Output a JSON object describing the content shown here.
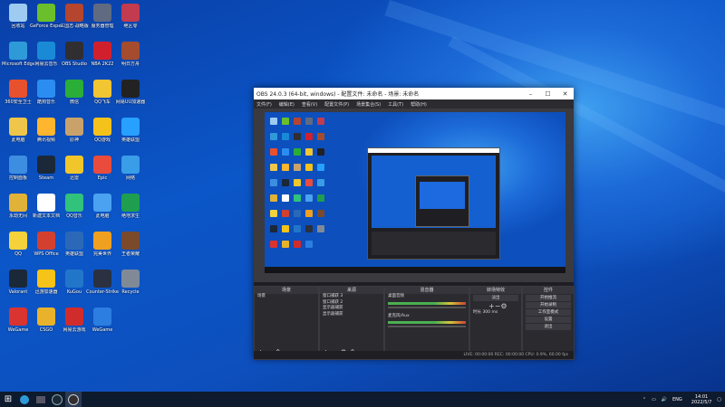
{
  "colors": {
    "desktop": "#0b56c8",
    "obs_bg": "#1f1f23",
    "accent": "#1c6ad8"
  },
  "desktop_icons": [
    {
      "label": "回收站",
      "color": "#9ecbf2"
    },
    {
      "label": "GeForce Experience",
      "color": "#6bbf2a"
    },
    {
      "label": "三国志·战略版",
      "color": "#b5452f"
    },
    {
      "label": "服务器管理",
      "color": "#606a80"
    },
    {
      "label": "绝区零",
      "color": "#c23b4e"
    },
    {
      "label": "Microsoft Edge",
      "color": "#2f9ad8"
    },
    {
      "label": "网易云音乐",
      "color": "#1a8ad6"
    },
    {
      "label": "OBS Studio",
      "color": "#302e31"
    },
    {
      "label": "NBA 2K22",
      "color": "#d1202d"
    },
    {
      "label": "明日方舟",
      "color": "#a44c2d"
    },
    {
      "label": "360安全卫士",
      "color": "#e8512d"
    },
    {
      "label": "酷狗音乐",
      "color": "#2c8df0"
    },
    {
      "label": "微信",
      "color": "#2aae38"
    },
    {
      "label": "QQ飞车",
      "color": "#f2c532"
    },
    {
      "label": "网易UU加速器",
      "color": "#222"
    },
    {
      "label": "此电脑",
      "color": "#f0c64a"
    },
    {
      "label": "腾讯视频",
      "color": "#ffb52e"
    },
    {
      "label": "原神",
      "color": "#c9a26b"
    },
    {
      "label": "QQ游戏",
      "color": "#f5c21b"
    },
    {
      "label": "英雄联盟",
      "color": "#28a0ff"
    },
    {
      "label": "控制面板",
      "color": "#3d8ee0"
    },
    {
      "label": "Steam",
      "color": "#1b2838"
    },
    {
      "label": "迅雷",
      "color": "#f1c62b"
    },
    {
      "label": "Epic",
      "color": "#e94b3c"
    },
    {
      "label": "网络",
      "color": "#3a9de8"
    },
    {
      "label": "永劫无间",
      "color": "#e0b237"
    },
    {
      "label": "新建文本文档",
      "color": "#ffffff"
    },
    {
      "label": "QQ音乐",
      "color": "#31c27c"
    },
    {
      "label": "此电脑",
      "color": "#4aa2f0"
    },
    {
      "label": "绝地求生",
      "color": "#1f9e4f"
    },
    {
      "label": "QQ",
      "color": "#f5d23c"
    },
    {
      "label": "WPS Office",
      "color": "#d4402f"
    },
    {
      "label": "英雄联盟",
      "color": "#2b69b8"
    },
    {
      "label": "完美世界",
      "color": "#f0a020"
    },
    {
      "label": "王者荣耀",
      "color": "#7a4a2a"
    },
    {
      "label": "Valorant",
      "color": "#1b2838"
    },
    {
      "label": "迅游加速器",
      "color": "#f6c319"
    },
    {
      "label": "KuGou",
      "color": "#2276c9"
    },
    {
      "label": "Counter-Strike",
      "color": "#2b3140"
    },
    {
      "label": "Recycle",
      "color": "#808a97"
    },
    {
      "label": "WeGame",
      "color": "#da3431"
    },
    {
      "label": "CSGO",
      "color": "#e8b32b"
    },
    {
      "label": "网易云游戏",
      "color": "#d12c2c"
    },
    {
      "label": "WeGame",
      "color": "#2c7ee0"
    }
  ],
  "obs": {
    "title": "OBS 24.0.3 (64-bit, windows) - 配置文件: 未命名 - 场景: 未命名",
    "menu": [
      "文件(F)",
      "编辑(E)",
      "查看(V)",
      "配置文件(P)",
      "场景集合(S)",
      "工具(T)",
      "帮助(H)"
    ],
    "docks": {
      "scenes": {
        "title": "场景",
        "items": [
          "场景"
        ]
      },
      "sources": {
        "title": "来源",
        "items": [
          "窗口捕获 3",
          "窗口捕获 2",
          "显示器捕获",
          "显示器捕获"
        ]
      },
      "mixer": {
        "title": "混音器",
        "items": [
          "桌面音频",
          "麦克风/Aux"
        ]
      },
      "transitions": {
        "title": "转场特效",
        "type": "淡出",
        "duration_label": "时长",
        "duration": "300 ms"
      },
      "controls": {
        "title": "控件",
        "buttons": [
          "开始推流",
          "开始录制",
          "工作室模式",
          "设置",
          "退出"
        ]
      }
    },
    "status": "LIVE: 00:00:00   REC: 00:00:00   CPU: 0.9%, 60.00 fps"
  },
  "taskbar": {
    "tray_lang": "ENG",
    "time": "14:01",
    "date": "2022/5/7"
  }
}
